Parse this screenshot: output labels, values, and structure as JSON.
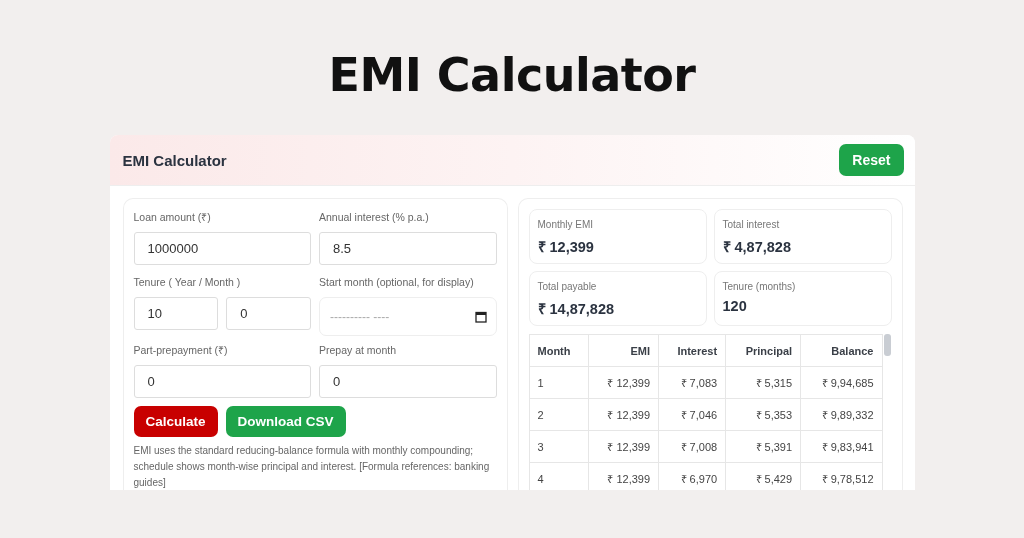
{
  "page_title": "EMI Calculator",
  "card": {
    "title": "EMI Calculator",
    "reset_button": "Reset"
  },
  "form": {
    "fields": [
      {
        "kind": "text",
        "label": "Loan amount (₹)",
        "value": "1000000"
      },
      {
        "kind": "text",
        "label": "Annual interest (% p.a.)",
        "value": "8.5"
      },
      {
        "kind": "pair",
        "label": "Tenure ( Year / Month )",
        "values": [
          "10",
          "0"
        ]
      },
      {
        "kind": "date",
        "label": "Start month (optional, for display)",
        "placeholder": "---------- ----"
      },
      {
        "kind": "text",
        "label": "Part-prepayment (₹)",
        "value": "0"
      },
      {
        "kind": "text",
        "label": "Prepay at month",
        "value": "0"
      }
    ],
    "buttons": [
      {
        "label": "Calculate",
        "color": "#c80000"
      },
      {
        "label": "Download CSV",
        "color": "#1ea44a"
      }
    ],
    "note": "EMI uses the standard reducing-balance formula with monthly compounding; schedule shows month-wise principal and interest. [Formula references: banking guides]"
  },
  "summary": [
    {
      "label": "Monthly EMI",
      "value": "₹ 12,399"
    },
    {
      "label": "Total interest",
      "value": "₹ 4,87,828"
    },
    {
      "label": "Total payable",
      "value": "₹ 14,87,828"
    },
    {
      "label": "Tenure (months)",
      "value": "120"
    }
  ],
  "table": {
    "columns": [
      "Month",
      "EMI",
      "Interest",
      "Principal",
      "Balance"
    ],
    "rows": [
      [
        "1",
        "₹ 12,399",
        "₹ 7,083",
        "₹ 5,315",
        "₹ 9,94,685"
      ],
      [
        "2",
        "₹ 12,399",
        "₹ 7,046",
        "₹ 5,353",
        "₹ 9,89,332"
      ],
      [
        "3",
        "₹ 12,399",
        "₹ 7,008",
        "₹ 5,391",
        "₹ 9,83,941"
      ],
      [
        "4",
        "₹ 12,399",
        "₹ 6,970",
        "₹ 5,429",
        "₹ 9,78,512"
      ]
    ]
  }
}
